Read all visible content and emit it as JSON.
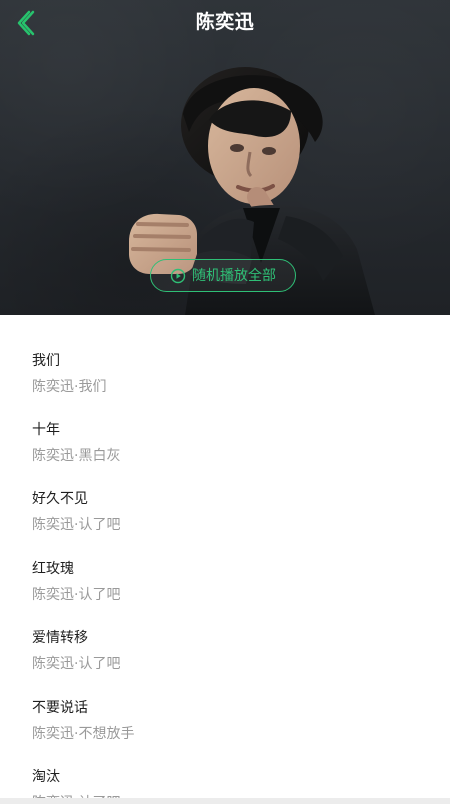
{
  "header": {
    "title": "陈奕迅",
    "back_icon": "chevron-left-icon",
    "accent": "#2fbf76"
  },
  "play_all": {
    "label": "随机播放全部",
    "icon": "play-circle-icon"
  },
  "songs": [
    {
      "title": "我们",
      "subtitle": "陈奕迅·我们"
    },
    {
      "title": "十年",
      "subtitle": "陈奕迅·黑白灰"
    },
    {
      "title": "好久不见",
      "subtitle": "陈奕迅·认了吧"
    },
    {
      "title": "红玫瑰",
      "subtitle": "陈奕迅·认了吧"
    },
    {
      "title": "爱情转移",
      "subtitle": "陈奕迅·认了吧"
    },
    {
      "title": "不要说话",
      "subtitle": "陈奕迅·不想放手"
    },
    {
      "title": "淘汰",
      "subtitle": "陈奕迅·认了吧"
    }
  ]
}
